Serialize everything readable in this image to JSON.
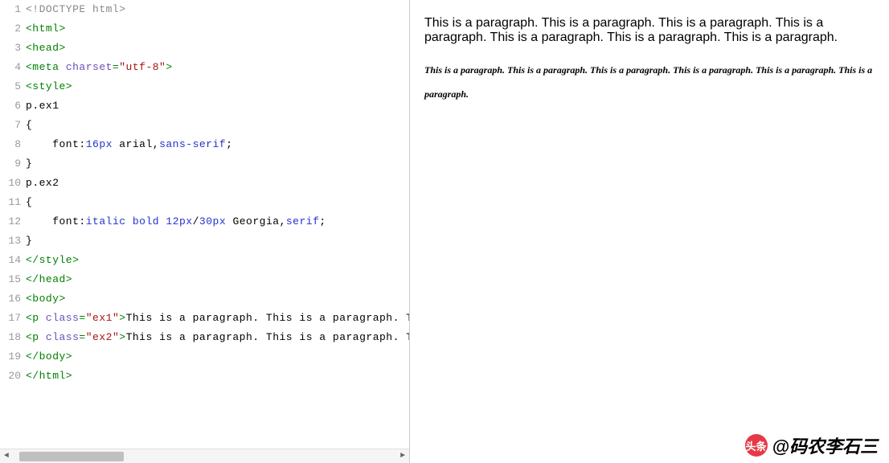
{
  "editor": {
    "lines": [
      {
        "n": 1,
        "tokens": [
          {
            "t": "<!DOCTYPE html>",
            "c": "tok-doctype"
          }
        ]
      },
      {
        "n": 2,
        "tokens": [
          {
            "t": "<html>",
            "c": "tok-tag"
          }
        ]
      },
      {
        "n": 3,
        "tokens": [
          {
            "t": "<head>",
            "c": "tok-tag"
          }
        ]
      },
      {
        "n": 4,
        "tokens": [
          {
            "t": "<meta ",
            "c": "tok-tag"
          },
          {
            "t": "charset",
            "c": "tok-attr"
          },
          {
            "t": "=",
            "c": "tok-tag"
          },
          {
            "t": "\"utf-8\"",
            "c": "tok-string"
          },
          {
            "t": ">",
            "c": "tok-tag"
          }
        ]
      },
      {
        "n": 5,
        "tokens": [
          {
            "t": "<style>",
            "c": "tok-tag"
          }
        ]
      },
      {
        "n": 6,
        "tokens": [
          {
            "t": "p",
            "c": "tok-ident"
          },
          {
            "t": ".",
            "c": "tok-plain"
          },
          {
            "t": "ex1",
            "c": "tok-ident"
          }
        ]
      },
      {
        "n": 7,
        "tokens": [
          {
            "t": "{",
            "c": "tok-plain"
          }
        ]
      },
      {
        "n": 8,
        "tokens": [
          {
            "t": "    font",
            "c": "tok-prop"
          },
          {
            "t": ":",
            "c": "tok-plain"
          },
          {
            "t": "16px",
            "c": "tok-blue"
          },
          {
            "t": " arial",
            "c": "tok-ident"
          },
          {
            "t": ",",
            "c": "tok-plain"
          },
          {
            "t": "sans-serif",
            "c": "tok-blue"
          },
          {
            "t": ";",
            "c": "tok-plain"
          }
        ]
      },
      {
        "n": 9,
        "tokens": [
          {
            "t": "}",
            "c": "tok-plain"
          }
        ]
      },
      {
        "n": 10,
        "tokens": [
          {
            "t": "p",
            "c": "tok-ident"
          },
          {
            "t": ".",
            "c": "tok-plain"
          },
          {
            "t": "ex2",
            "c": "tok-ident"
          }
        ]
      },
      {
        "n": 11,
        "tokens": [
          {
            "t": "{",
            "c": "tok-plain"
          }
        ]
      },
      {
        "n": 12,
        "tokens": [
          {
            "t": "    font",
            "c": "tok-prop"
          },
          {
            "t": ":",
            "c": "tok-plain"
          },
          {
            "t": "italic",
            "c": "tok-blue"
          },
          {
            "t": " ",
            "c": "tok-plain"
          },
          {
            "t": "bold",
            "c": "tok-blue"
          },
          {
            "t": " ",
            "c": "tok-plain"
          },
          {
            "t": "12px",
            "c": "tok-blue"
          },
          {
            "t": "/",
            "c": "tok-plain"
          },
          {
            "t": "30px",
            "c": "tok-blue"
          },
          {
            "t": " Georgia",
            "c": "tok-ident"
          },
          {
            "t": ",",
            "c": "tok-plain"
          },
          {
            "t": "serif",
            "c": "tok-blue"
          },
          {
            "t": ";",
            "c": "tok-plain"
          }
        ]
      },
      {
        "n": 13,
        "tokens": [
          {
            "t": "}",
            "c": "tok-plain"
          }
        ]
      },
      {
        "n": 14,
        "tokens": [
          {
            "t": "</style>",
            "c": "tok-tag"
          }
        ]
      },
      {
        "n": 15,
        "tokens": [
          {
            "t": "</head>",
            "c": "tok-tag"
          }
        ]
      },
      {
        "n": 16,
        "tokens": [
          {
            "t": "<body>",
            "c": "tok-tag"
          }
        ]
      },
      {
        "n": 17,
        "tokens": [
          {
            "t": "<p ",
            "c": "tok-tag"
          },
          {
            "t": "class",
            "c": "tok-attr"
          },
          {
            "t": "=",
            "c": "tok-tag"
          },
          {
            "t": "\"ex1\"",
            "c": "tok-string"
          },
          {
            "t": ">",
            "c": "tok-tag"
          },
          {
            "t": "This is a paragraph. This is a paragraph. Thi",
            "c": "tok-plain"
          }
        ]
      },
      {
        "n": 18,
        "tokens": [
          {
            "t": "<p ",
            "c": "tok-tag"
          },
          {
            "t": "class",
            "c": "tok-attr"
          },
          {
            "t": "=",
            "c": "tok-tag"
          },
          {
            "t": "\"ex2\"",
            "c": "tok-string"
          },
          {
            "t": ">",
            "c": "tok-tag"
          },
          {
            "t": "This is a paragraph. This is a paragraph. Thi",
            "c": "tok-plain"
          }
        ]
      },
      {
        "n": 19,
        "tokens": [
          {
            "t": "</body>",
            "c": "tok-tag"
          }
        ]
      },
      {
        "n": 20,
        "tokens": [
          {
            "t": "</html>",
            "c": "tok-tag"
          }
        ]
      }
    ]
  },
  "preview": {
    "p1": "This is a paragraph. This is a paragraph. This is a paragraph. This is a paragraph. This is a paragraph. This is a paragraph. This is a paragraph.",
    "p2": "This is a paragraph. This is a paragraph. This is a paragraph. This is a paragraph. This is a paragraph. This is a paragraph."
  },
  "watermark": {
    "logo_text": "头条",
    "text": "@码农李石三"
  },
  "scroll": {
    "left_arrow": "◄",
    "right_arrow": "►"
  }
}
